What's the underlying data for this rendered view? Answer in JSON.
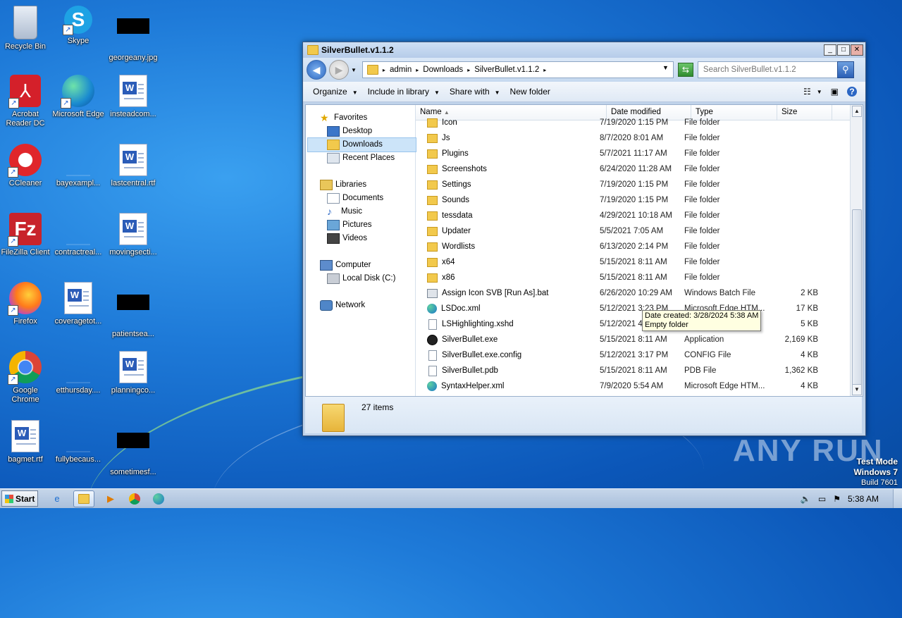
{
  "desktop": {
    "icons": [
      {
        "label": "Recycle Bin",
        "kind": "recycle",
        "shortcut": false
      },
      {
        "label": "Skype",
        "kind": "skype",
        "shortcut": true
      },
      {
        "label": "georgeany.jpg",
        "kind": "black",
        "shortcut": false
      },
      {
        "label": "Acrobat\nReader DC",
        "kind": "acrobat",
        "shortcut": true
      },
      {
        "label": "Microsoft Edge",
        "kind": "edge",
        "shortcut": true
      },
      {
        "label": "insteadcom...",
        "kind": "word",
        "shortcut": false
      },
      {
        "label": "CCleaner",
        "kind": "ccleaner",
        "shortcut": true
      },
      {
        "label": "bayexampl...",
        "kind": "blank",
        "shortcut": false
      },
      {
        "label": "lastcentral.rtf",
        "kind": "word",
        "shortcut": false
      },
      {
        "label": "FileZilla Client",
        "kind": "filezilla",
        "shortcut": true
      },
      {
        "label": "contractreal...",
        "kind": "blank",
        "shortcut": false
      },
      {
        "label": "movingsecti...",
        "kind": "word",
        "shortcut": false
      },
      {
        "label": "Firefox",
        "kind": "firefox",
        "shortcut": true
      },
      {
        "label": "coveragetot...",
        "kind": "word",
        "shortcut": false
      },
      {
        "label": "patientsea...",
        "kind": "black",
        "shortcut": false
      },
      {
        "label": "Google\nChrome",
        "kind": "chrome",
        "shortcut": true
      },
      {
        "label": "etthursday....",
        "kind": "blank",
        "shortcut": false
      },
      {
        "label": "planningco...",
        "kind": "word",
        "shortcut": false
      },
      {
        "label": "bagmet.rtf",
        "kind": "word",
        "shortcut": false
      },
      {
        "label": "fullybecaus...",
        "kind": "blank",
        "shortcut": false
      },
      {
        "label": "sometimesf...",
        "kind": "black",
        "shortcut": false
      }
    ]
  },
  "window": {
    "title": "SilverBullet.v1.1.2",
    "buttons": {
      "minimize": "_",
      "maximize": "□",
      "close": "✕"
    },
    "address": {
      "parts": [
        "admin",
        "Downloads",
        "SilverBullet.v1.1.2"
      ],
      "separator": "▸"
    },
    "search_placeholder": "Search SilverBullet.v1.1.2",
    "commands": [
      "Organize",
      "Include in library",
      "Share with",
      "New folder"
    ],
    "nav": {
      "favorites": "Favorites",
      "desktop": "Desktop",
      "downloads": "Downloads",
      "recent": "Recent Places",
      "libraries": "Libraries",
      "documents": "Documents",
      "music": "Music",
      "pictures": "Pictures",
      "videos": "Videos",
      "computer": "Computer",
      "localdisk": "Local Disk (C:)",
      "network": "Network"
    },
    "columns": {
      "name": "Name",
      "date": "Date modified",
      "type": "Type",
      "size": "Size"
    },
    "files": [
      {
        "name": "Icon",
        "date": "7/19/2020 1:15 PM",
        "type": "File folder",
        "size": "",
        "icon": "folder"
      },
      {
        "name": "Js",
        "date": "8/7/2020 8:01 AM",
        "type": "File folder",
        "size": "",
        "icon": "folder"
      },
      {
        "name": "Plugins",
        "date": "5/7/2021 11:17 AM",
        "type": "File folder",
        "size": "",
        "icon": "folder"
      },
      {
        "name": "Screenshots",
        "date": "6/24/2020 11:28 AM",
        "type": "File folder",
        "size": "",
        "icon": "folder"
      },
      {
        "name": "Settings",
        "date": "7/19/2020 1:15 PM",
        "type": "File folder",
        "size": "",
        "icon": "folder"
      },
      {
        "name": "Sounds",
        "date": "7/19/2020 1:15 PM",
        "type": "File folder",
        "size": "",
        "icon": "folder"
      },
      {
        "name": "tessdata",
        "date": "4/29/2021 10:18 AM",
        "type": "File folder",
        "size": "",
        "icon": "folder"
      },
      {
        "name": "Updater",
        "date": "5/5/2021 7:05 AM",
        "type": "File folder",
        "size": "",
        "icon": "folder"
      },
      {
        "name": "Wordlists",
        "date": "6/13/2020 2:14 PM",
        "type": "File folder",
        "size": "",
        "icon": "folder"
      },
      {
        "name": "x64",
        "date": "5/15/2021 8:11 AM",
        "type": "File folder",
        "size": "",
        "icon": "folder"
      },
      {
        "name": "x86",
        "date": "5/15/2021 8:11 AM",
        "type": "File folder",
        "size": "",
        "icon": "folder"
      },
      {
        "name": "Assign Icon SVB [Run As].bat",
        "date": "6/26/2020 10:29 AM",
        "type": "Windows Batch File",
        "size": "2 KB",
        "icon": "bat"
      },
      {
        "name": "LSDoc.xml",
        "date": "5/12/2021 3:23 PM",
        "type": "Microsoft Edge HTM...",
        "size": "17 KB",
        "icon": "edge"
      },
      {
        "name": "LSHighlighting.xshd",
        "date": "5/12/2021 4:02 PM",
        "type": "XSHD File",
        "size": "5 KB",
        "icon": "doc"
      },
      {
        "name": "SilverBullet.exe",
        "date": "5/15/2021 8:11 AM",
        "type": "Application",
        "size": "2,169 KB",
        "icon": "app"
      },
      {
        "name": "SilverBullet.exe.config",
        "date": "5/12/2021 3:17 PM",
        "type": "CONFIG File",
        "size": "4 KB",
        "icon": "doc"
      },
      {
        "name": "SilverBullet.pdb",
        "date": "5/15/2021 8:11 AM",
        "type": "PDB File",
        "size": "1,362 KB",
        "icon": "doc"
      },
      {
        "name": "SyntaxHelper.xml",
        "date": "7/9/2020 5:54 AM",
        "type": "Microsoft Edge HTM...",
        "size": "4 KB",
        "icon": "edge"
      }
    ],
    "tooltip": "Date created: 3/28/2024 5:38 AM\nEmpty folder",
    "item_count": "27 items"
  },
  "taskbar": {
    "start_label": "Start",
    "clock": "5:38 AM"
  },
  "watermark": "ANY RUN",
  "test_mode": {
    "line1": "Test Mode",
    "line2": "Windows 7",
    "line3": "Build 7601"
  }
}
